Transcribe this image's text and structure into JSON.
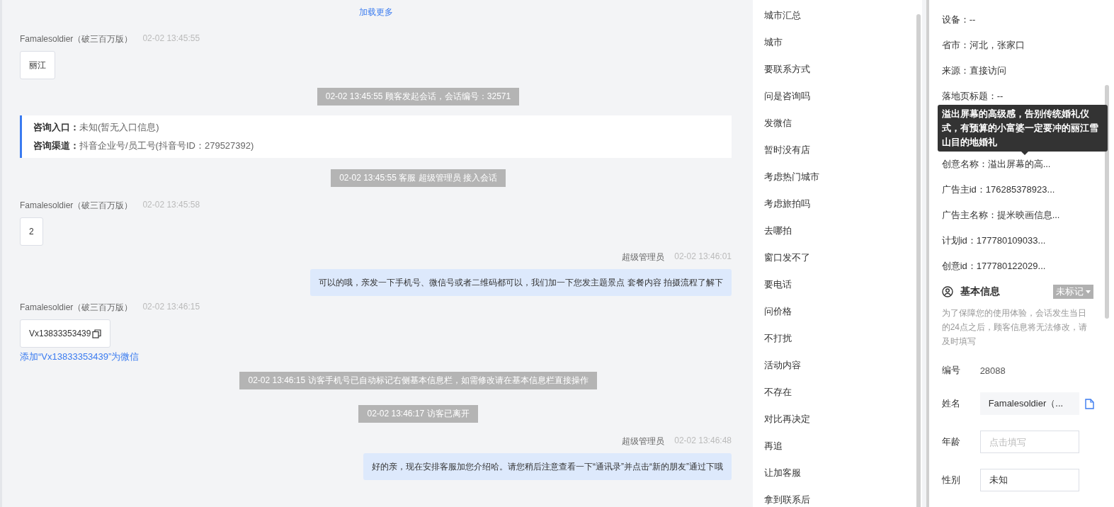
{
  "chat": {
    "load_more": "加载更多",
    "messages": [
      {
        "kind": "customer",
        "name": "Famalesoldier（破三百万版）",
        "time": "02-02 13:45:55",
        "text": "丽江"
      },
      {
        "kind": "system",
        "text": "02-02 13:45:55 顾客发起会话，会话编号：32571"
      },
      {
        "kind": "entry",
        "lines": [
          {
            "label": "咨询入口：",
            "value": "未知(暂无入口信息)"
          },
          {
            "label": "咨询渠道：",
            "value": "抖音企业号/员工号(抖音号ID：279527392)"
          }
        ]
      },
      {
        "kind": "system",
        "text": "02-02 13:45:55 客服 超级管理员 接入会话"
      },
      {
        "kind": "customer",
        "name": "Famalesoldier（破三百万版）",
        "time": "02-02 13:45:58",
        "text": "2"
      },
      {
        "kind": "agent",
        "name": "超级管理员",
        "time": "02-02 13:46:01",
        "text": "可以的哦，亲发一下手机号、微信号或者二维码都可以，我们加一下您发主题景点 套餐内容 拍摄流程了解下"
      },
      {
        "kind": "customer",
        "name": "Famalesoldier（破三百万版）",
        "time": "02-02 13:46:15",
        "text": "Vx13833353439",
        "copyable": true,
        "link": "添加“Vx13833353439”为微信"
      },
      {
        "kind": "system",
        "text": "02-02 13:46:15 访客手机号已自动标记右侧基本信息栏，如需修改请在基本信息栏直接操作"
      },
      {
        "kind": "system",
        "text": "02-02 13:46:17 访客已离开"
      },
      {
        "kind": "agent",
        "name": "超级管理员",
        "time": "02-02 13:46:48",
        "text": "好的亲，现在安排客服加您介绍哈。请您稍后注意查看一下“通讯录”并点击“新的朋友”通过下哦"
      }
    ]
  },
  "quick_replies": [
    "城市汇总",
    "城市",
    "要联系方式",
    "问是咨询吗",
    "发微信",
    "暂时没有店",
    "考虑热门城市",
    "考虑旅拍吗",
    "去哪拍",
    "窗口发不了",
    "要电话",
    "问价格",
    "不打扰",
    "活动内容",
    "不存在",
    "对比再决定",
    "再追",
    "让加客服",
    "拿到联系后"
  ],
  "visitor": {
    "fields_top": [
      "设备：--",
      "省市：河北，张家口",
      "来源：直接访问",
      "落地页标题：--"
    ],
    "tooltip": "溢出屏幕的高级感，告别传统婚礼仪式，有预算的小富婆一定要冲的丽江雪山目的地婚礼",
    "fields_bottom": [
      "创意名称：溢出屏幕的高...",
      "广告主id：176285378923...",
      "广告主名称：提米映画信息...",
      "计划id：177780109033...",
      "创意id：177780122029..."
    ]
  },
  "basic_info": {
    "title": "基本信息",
    "tag": "未标记",
    "note": "为了保障您的使用体验，会话发生当日的24点之后，顾客信息将无法修改，请及时填写",
    "rows": [
      {
        "kind": "static",
        "label": "编号",
        "value": "28088"
      },
      {
        "kind": "copy",
        "label": "姓名",
        "value": "Famalesoldier（..."
      },
      {
        "kind": "input",
        "label": "年龄",
        "placeholder": "点击填写"
      },
      {
        "kind": "select",
        "label": "性别",
        "value": "未知"
      }
    ]
  }
}
